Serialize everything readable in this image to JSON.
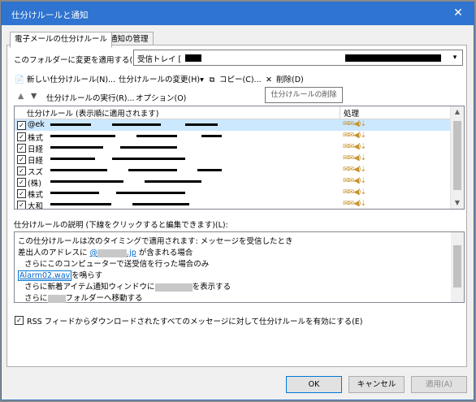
{
  "window": {
    "title": "仕分けルールと通知",
    "close_glyph": "✕"
  },
  "tabs": [
    {
      "label": "電子メールの仕分けルール"
    },
    {
      "label": "通知の管理"
    }
  ],
  "folder": {
    "label": "このフォルダーに変更を適用する(F):",
    "value": "受信トレイ [",
    "caret": "▾"
  },
  "toolbar": {
    "new_rule": {
      "icon": "new-rule-icon",
      "label": "新しい仕分けルール(N)..."
    },
    "change_rule": {
      "label": "仕分けルールの変更(H)",
      "caret": "▾"
    },
    "copy": {
      "icon": "copy-icon",
      "label": "コピー(C)..."
    },
    "delete": {
      "icon": "delete-icon",
      "glyph": "✕",
      "label": "削除(D)"
    },
    "tooltip": "仕分けルールの削除",
    "move_up": "▲",
    "move_down": "▼",
    "run_rules": "仕分けルールの実行(R)...",
    "options": "オプション(O)"
  },
  "rules_grid": {
    "col_name": "仕分けルール (表示順に適用されます)",
    "col_action": "処理",
    "rows": [
      {
        "name": "@ek",
        "checked": true,
        "selected": true
      },
      {
        "name": "株式",
        "checked": true
      },
      {
        "name": "日経",
        "checked": true
      },
      {
        "name": "日経",
        "checked": true
      },
      {
        "name": "スズ",
        "checked": true
      },
      {
        "name": "(株)",
        "checked": true
      },
      {
        "name": "株式",
        "checked": true
      },
      {
        "name": "大和",
        "checked": true
      }
    ],
    "action_glyphs": "✉✉◀)⇣"
  },
  "description": {
    "label": "仕分けルールの説明 (下線をクリックすると編集できます)(L):",
    "line1": "この仕分けルールは次のタイミングで適用されます: メッセージを受信したとき",
    "line2_prefix": "差出人のアドレスに",
    "line2_link_start": "@",
    "line2_link_end": ".jp",
    "line2_suffix": "が含まれる場合",
    "line3": "さらにこのコンピューターで送受信を行った場合のみ",
    "line4_link": "Alarm02.wav",
    "line4_suffix": "を鳴らす",
    "line5_prefix": "さらに新着アイテム通知ウィンドウに",
    "line5_suffix": "を表示する",
    "line6_prefix": "さらに",
    "line6_suffix": "フォルダーへ移動する"
  },
  "rss": {
    "label": "RSS フィードからダウンロードされたすべてのメッセージに対して仕分けルールを有効にする(E)",
    "checked": true
  },
  "buttons": {
    "ok": "OK",
    "cancel": "キャンセル",
    "apply": "適用(A)"
  }
}
